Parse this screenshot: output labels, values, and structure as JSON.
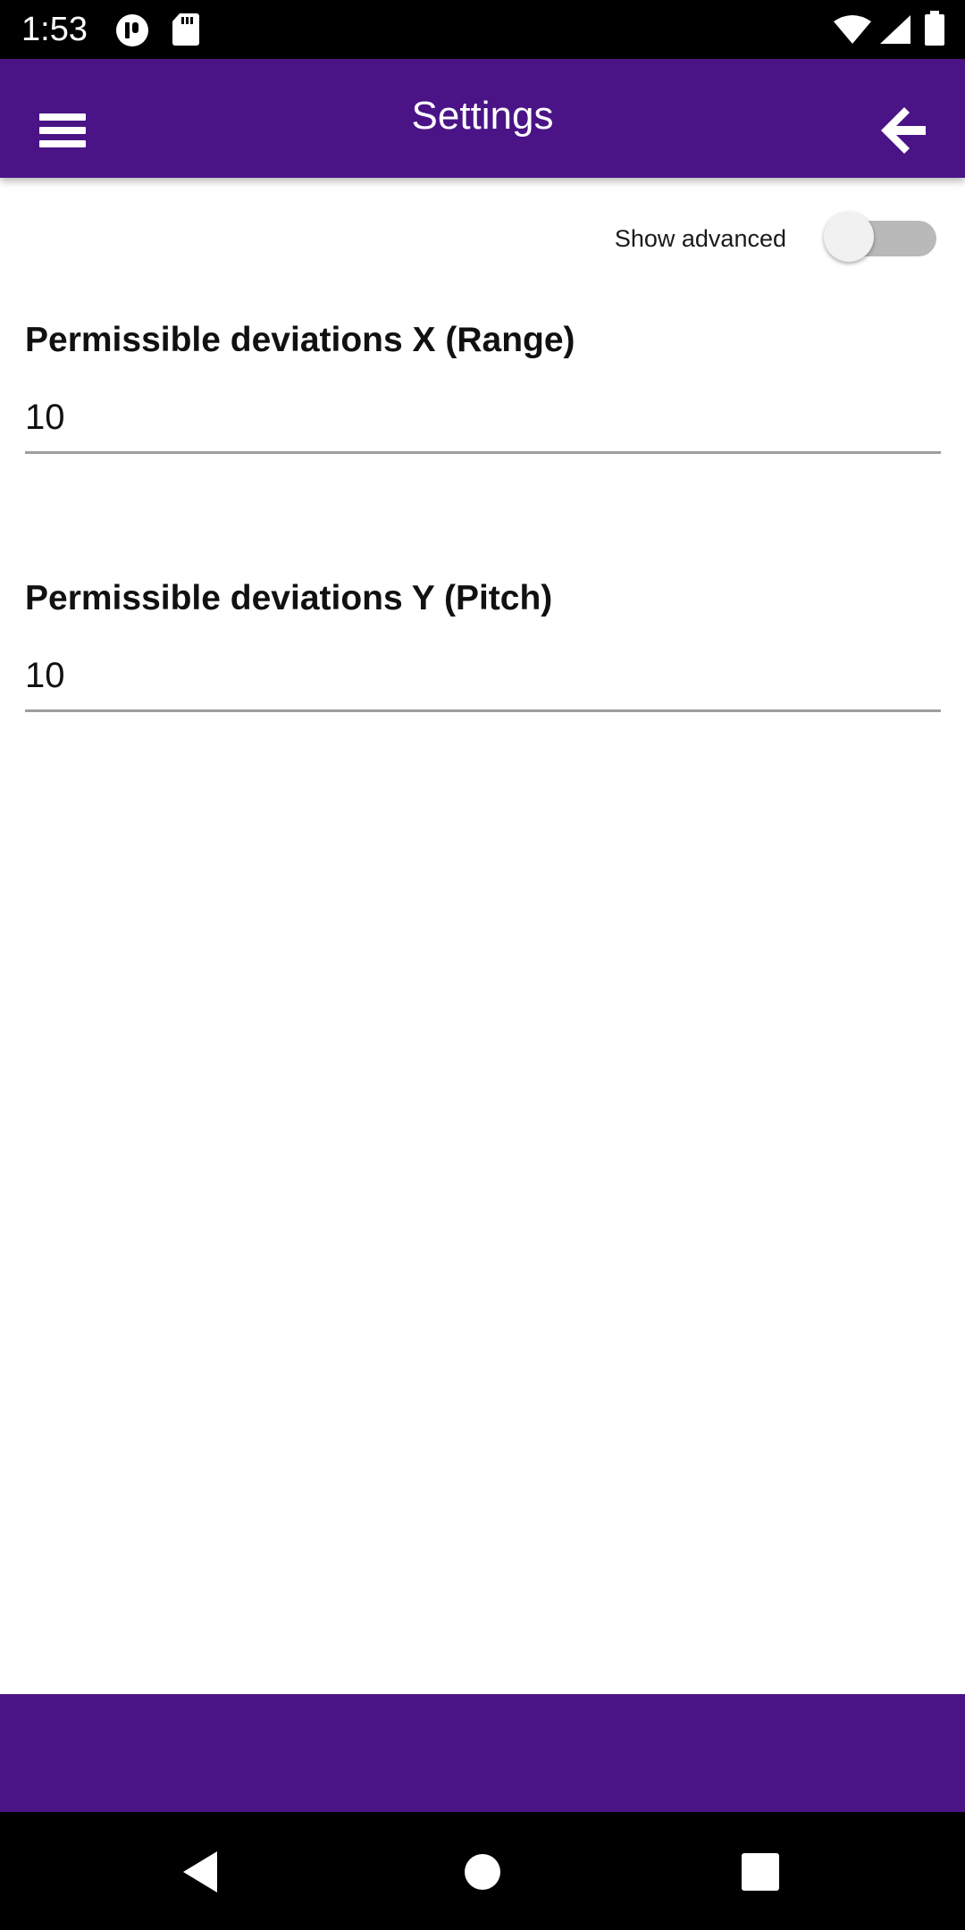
{
  "status_bar": {
    "time": "1:53",
    "icons": [
      "notification-badge-icon",
      "sd-card-icon",
      "wifi-icon",
      "cell-signal-icon",
      "battery-icon"
    ]
  },
  "app_bar": {
    "title": "Settings",
    "menu_icon": "hamburger-menu-icon",
    "back_icon": "arrow-back-icon",
    "background": "#4a1487"
  },
  "settings": {
    "show_advanced": {
      "label": "Show advanced",
      "checked": false
    },
    "fields": [
      {
        "label": "Permissible deviations X (Range)",
        "value": "10"
      },
      {
        "label": "Permissible deviations Y (Pitch)",
        "value": "10"
      }
    ]
  },
  "bottom_bar": {
    "background": "#4a1487"
  },
  "nav_bar": {
    "icons": [
      "back-triangle-icon",
      "home-circle-icon",
      "recents-square-icon"
    ]
  }
}
